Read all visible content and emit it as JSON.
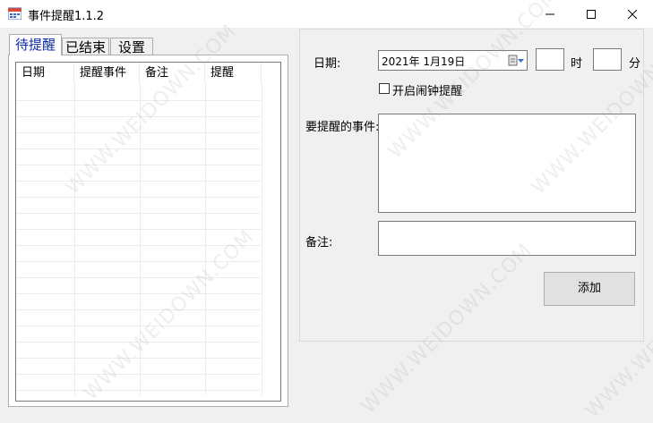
{
  "window": {
    "title": "事件提醒1.1.2",
    "buttons": [
      "minimize",
      "maximize",
      "close"
    ]
  },
  "tabs": [
    {
      "label": "待提醒",
      "active": true
    },
    {
      "label": "已结束",
      "active": false
    },
    {
      "label": "设置",
      "active": false
    }
  ],
  "grid": {
    "columns": [
      "日期",
      "提醒事件",
      "备注",
      "提醒"
    ],
    "rows": []
  },
  "form": {
    "date_label": "日期:",
    "date_value": "2021年  1月19日",
    "hour_label": "时",
    "minute_label": "分",
    "hour_value": "",
    "minute_value": "",
    "alarm_checkbox_label": "开启闹钟提醒",
    "alarm_checked": false,
    "event_label": "要提醒的事件:",
    "event_value": "",
    "note_label": "备注:",
    "note_value": "",
    "add_button": "添加"
  },
  "watermark": "WWW.WEIDOWN.COM",
  "colors": {
    "active_tab_text": "#0e2aa6",
    "background": "#f0f0f0"
  }
}
